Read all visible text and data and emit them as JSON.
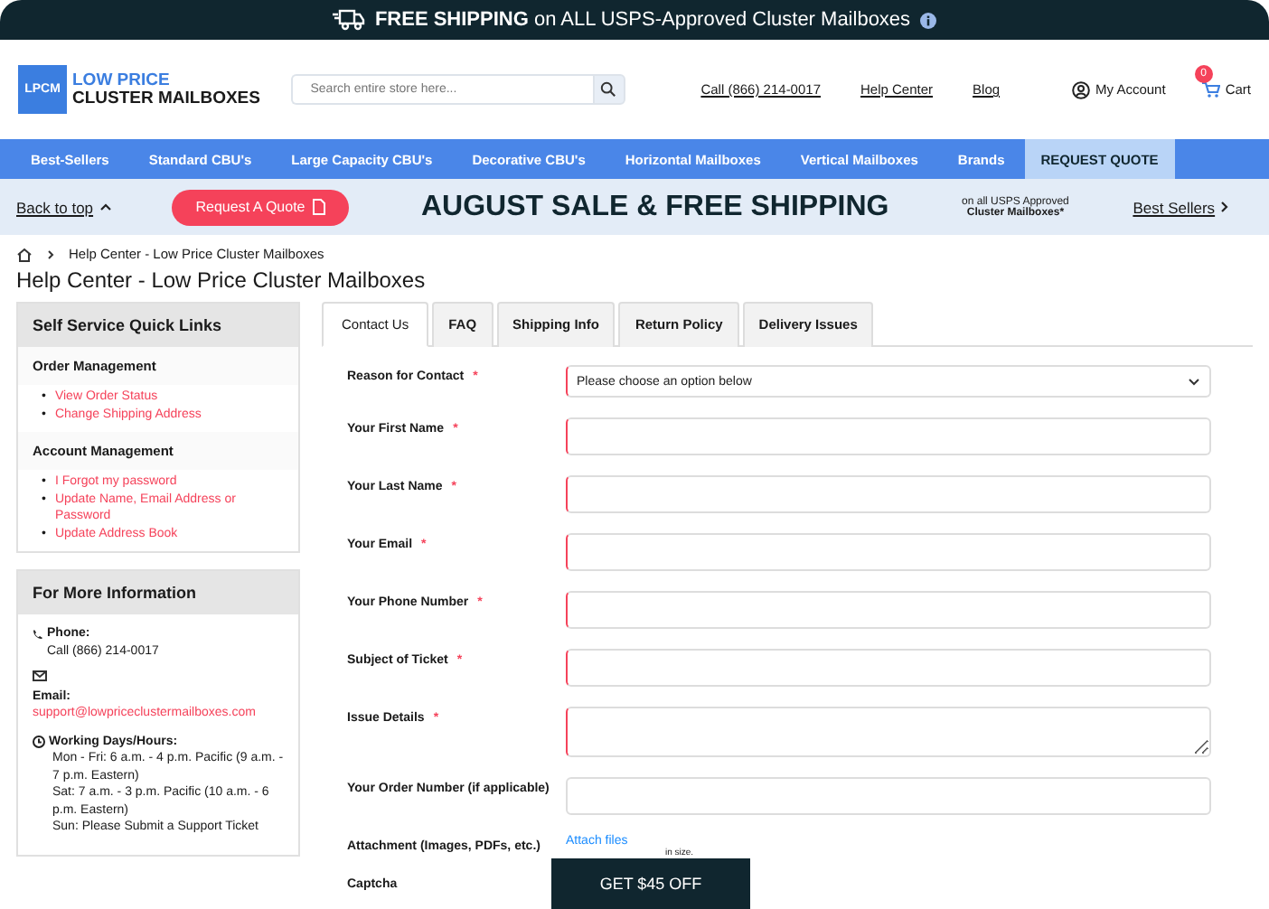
{
  "top_banner": {
    "bold": "FREE SHIPPING",
    "text": "on ALL USPS-Approved Cluster Mailboxes"
  },
  "header": {
    "logo_mark": "LPCM",
    "logo_line1": "LOW PRICE",
    "logo_line2": "CLUSTER MAILBOXES",
    "search": {
      "placeholder": "Search entire store here..."
    },
    "links": [
      "Call (866) 214-0017",
      "Help Center",
      "Blog"
    ],
    "account": "My Account",
    "cart": {
      "label": "Cart",
      "count": "0"
    }
  },
  "nav": [
    {
      "label": "Best-Sellers",
      "selected": false
    },
    {
      "label": "Standard CBU's",
      "selected": false
    },
    {
      "label": "Large Capacity CBU's",
      "selected": false
    },
    {
      "label": "Decorative CBU's",
      "selected": false
    },
    {
      "label": "Horizontal Mailboxes",
      "selected": false
    },
    {
      "label": "Vertical Mailboxes",
      "selected": false
    },
    {
      "label": "Brands",
      "selected": false
    },
    {
      "label": "REQUEST QUOTE",
      "selected": true
    }
  ],
  "promo": {
    "back_to_top": "Back to top",
    "quote_button": "Request A Quote",
    "headline": "AUGUST SALE & FREE SHIPPING",
    "note_line1": "on all USPS Approved",
    "note_line2": "Cluster Mailboxes*",
    "best_sellers": "Best Sellers"
  },
  "breadcrumb": [
    "Help Center - Low Price Cluster Mailboxes"
  ],
  "page_title": "Help Center - Low Price Cluster Mailboxes",
  "sidebar": [
    {
      "title": "Self Service Quick Links",
      "kind": "links",
      "bullet": "•",
      "groups": [
        {
          "heading": "Order Management",
          "links": [
            "View Order Status",
            "Change Shipping Address"
          ]
        },
        {
          "heading": "Account Management",
          "links": [
            "I Forgot my password",
            "Update Name, Email Address or Password",
            "Update Address Book"
          ]
        }
      ]
    },
    {
      "title": "For More Information",
      "kind": "contact",
      "phone_label": "Phone:",
      "phone": "Call (866) 214-0017",
      "email_label": "Email:",
      "email": "support@lowpriceclustermailboxes.com",
      "hours_label": "Working Days/Hours:",
      "hours": [
        "Mon - Fri: 6 a.m. - 4 p.m. Pacific (9 a.m. - 7 p.m. Eastern)",
        "Sat: 7 a.m. - 3 p.m. Pacific (10 a.m. - 6 p.m. Eastern)",
        "Sun: Please Submit a Support Ticket"
      ]
    }
  ],
  "tabs": [
    {
      "label": "Contact Us",
      "selected": true
    },
    {
      "label": "FAQ",
      "selected": false
    },
    {
      "label": "Shipping Info",
      "selected": false
    },
    {
      "label": "Return Policy",
      "selected": false
    },
    {
      "label": "Delivery Issues",
      "selected": false
    }
  ],
  "required_mark": "*",
  "form": [
    {
      "label": "Reason for Contact",
      "kind": "select",
      "required": true,
      "value": "Please choose an option below"
    },
    {
      "label": "Your First Name",
      "kind": "input",
      "required": true
    },
    {
      "label": "Your Last Name",
      "kind": "input",
      "required": true
    },
    {
      "label": "Your Email",
      "kind": "input",
      "required": true
    },
    {
      "label": "Your Phone Number",
      "kind": "input",
      "required": true
    },
    {
      "label": "Subject of Ticket",
      "kind": "input",
      "required": true
    },
    {
      "label": "Issue Details",
      "kind": "textarea",
      "required": true
    },
    {
      "label": "Your Order Number (if applicable)",
      "kind": "input",
      "required": false
    },
    {
      "label": "Attachment (Images, PDFs, etc.)",
      "kind": "file",
      "required": false,
      "link": "Attach files",
      "note": "in size."
    },
    {
      "label": "Captcha",
      "kind": "captcha"
    }
  ],
  "discount_button": "GET $45 OFF"
}
